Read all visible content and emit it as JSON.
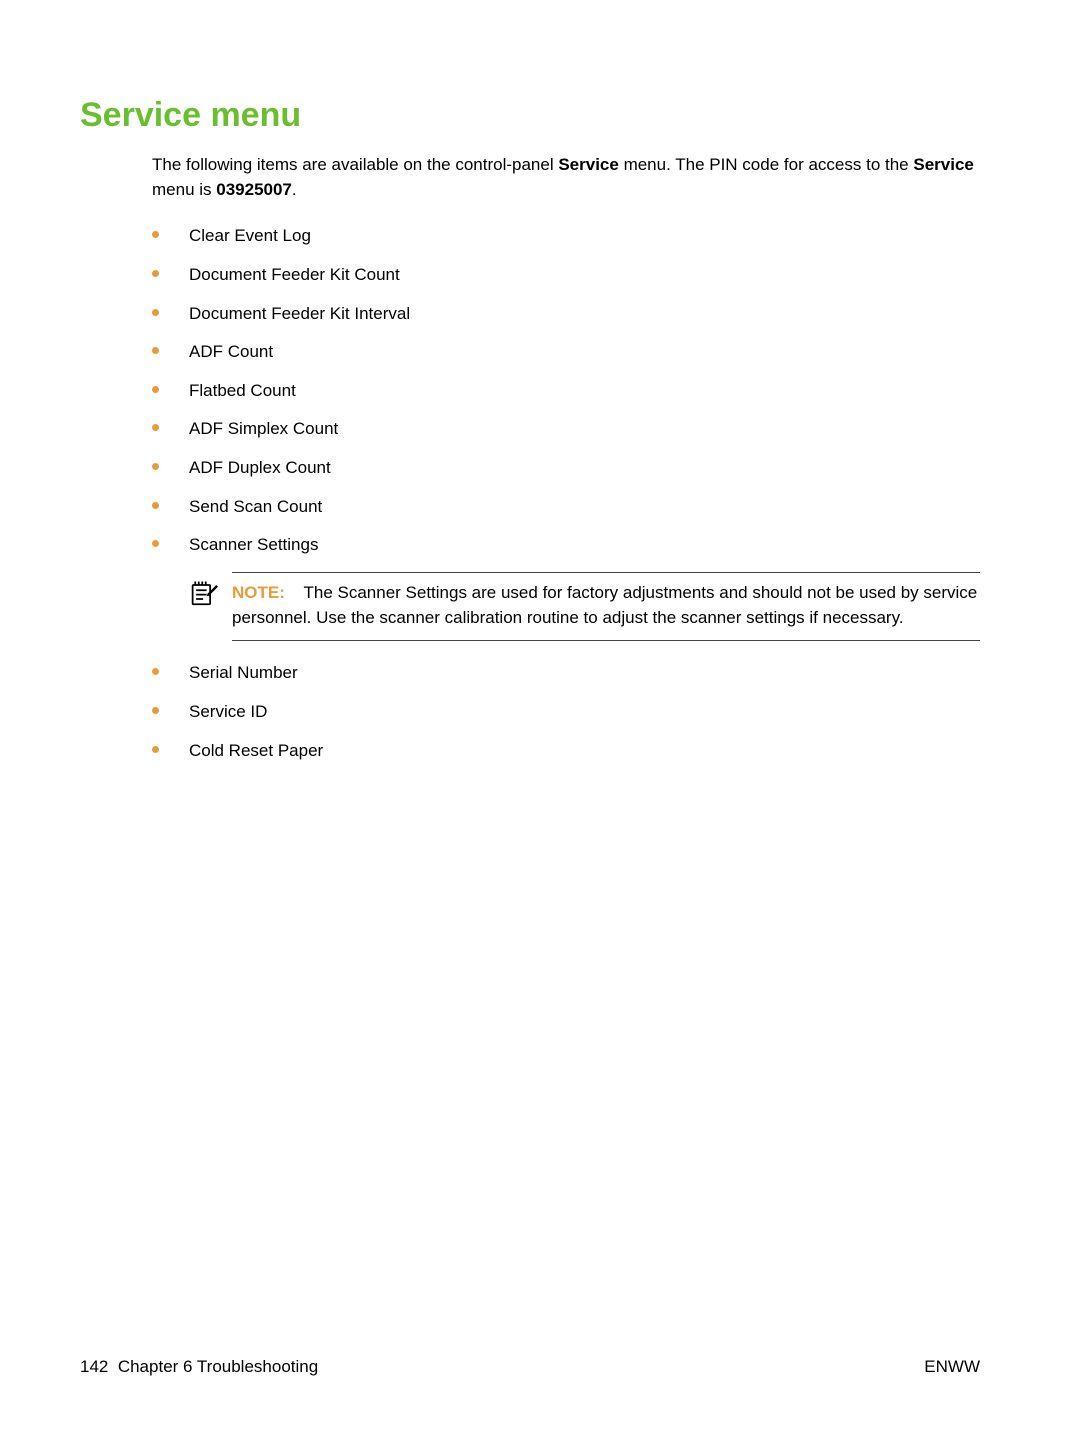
{
  "heading": "Service menu",
  "intro": {
    "part1": "The following items are available on the control-panel ",
    "bold1": "Service",
    "part2": " menu. The PIN code for access to the ",
    "bold2": "Service",
    "part3": " menu is ",
    "bold3": "03925007",
    "part4": "."
  },
  "list1": [
    "Clear Event Log",
    "Document Feeder Kit Count",
    "Document Feeder Kit Interval",
    "ADF Count",
    "Flatbed Count",
    "ADF Simplex Count",
    "ADF Duplex Count",
    "Send Scan Count",
    "Scanner Settings"
  ],
  "note": {
    "label": "NOTE:",
    "text": " The Scanner Settings are used for factory adjustments and should not be used by service personnel. Use the scanner calibration routine to adjust the scanner settings if necessary."
  },
  "list2": [
    "Serial Number",
    "Service ID",
    "Cold Reset Paper"
  ],
  "footer": {
    "page_number": "142",
    "chapter": "Chapter 6   Troubleshooting",
    "right": "ENWW"
  }
}
